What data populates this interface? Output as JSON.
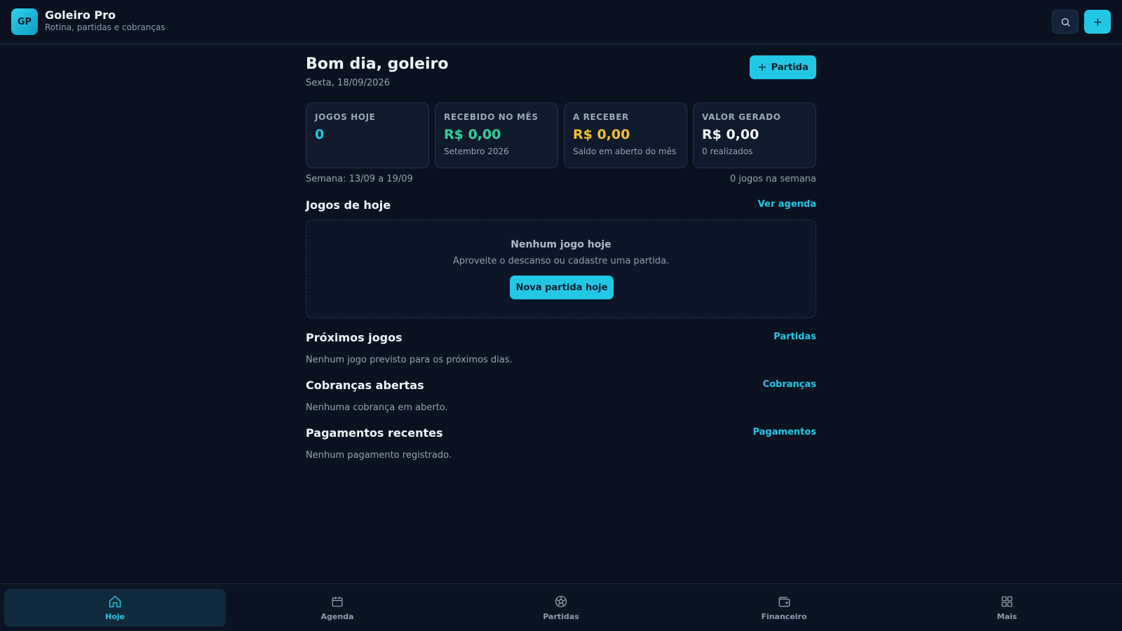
{
  "app": {
    "logo_text": "GP",
    "title": "Goleiro Pro",
    "subtitle": "Rotina, partidas e cobranças"
  },
  "header_actions": {
    "search_icon": "search-icon",
    "add_icon": "plus-icon"
  },
  "greeting": {
    "title": "Bom dia, goleiro",
    "date": "Sexta, 18/09/2026",
    "new_match_button": "Partida"
  },
  "stats": [
    {
      "label": "JOGOS HOJE",
      "value": "0",
      "note": "",
      "color": "#22c7e6"
    },
    {
      "label": "RECEBIDO NO MÊS",
      "value": "R$ 0,00",
      "note": "Setembro 2026",
      "color": "#2fd39a"
    },
    {
      "label": "A RECEBER",
      "value": "R$ 0,00",
      "note": "Saldo em aberto do mês",
      "color": "#f5c02a"
    },
    {
      "label": "VALOR GERADO",
      "value": "R$ 0,00",
      "note": "0 realizados",
      "color": "#f4f7fb"
    }
  ],
  "week": {
    "range": "Semana: 13/09 a 19/09",
    "count": "0 jogos na semana"
  },
  "today_games": {
    "title": "Jogos de hoje",
    "link": "Ver agenda",
    "empty_title": "Nenhum jogo hoje",
    "empty_subtitle": "Aproveite o descanso ou cadastre uma partida.",
    "empty_button": "Nova partida hoje"
  },
  "upcoming": {
    "title": "Próximos jogos",
    "link": "Partidas",
    "empty": "Nenhum jogo previsto para os próximos dias."
  },
  "open_charges": {
    "title": "Cobranças abertas",
    "link": "Cobranças",
    "empty": "Nenhuma cobrança em aberto."
  },
  "recent_payments": {
    "title": "Pagamentos recentes",
    "link": "Pagamentos",
    "empty": "Nenhum pagamento registrado."
  },
  "nav": [
    {
      "label": "Hoje",
      "icon": "home-icon",
      "active": true
    },
    {
      "label": "Agenda",
      "icon": "calendar-icon",
      "active": false
    },
    {
      "label": "Partidas",
      "icon": "soccer-ball-icon",
      "active": false
    },
    {
      "label": "Financeiro",
      "icon": "wallet-icon",
      "active": false
    },
    {
      "label": "Mais",
      "icon": "grid-icon",
      "active": false
    }
  ]
}
